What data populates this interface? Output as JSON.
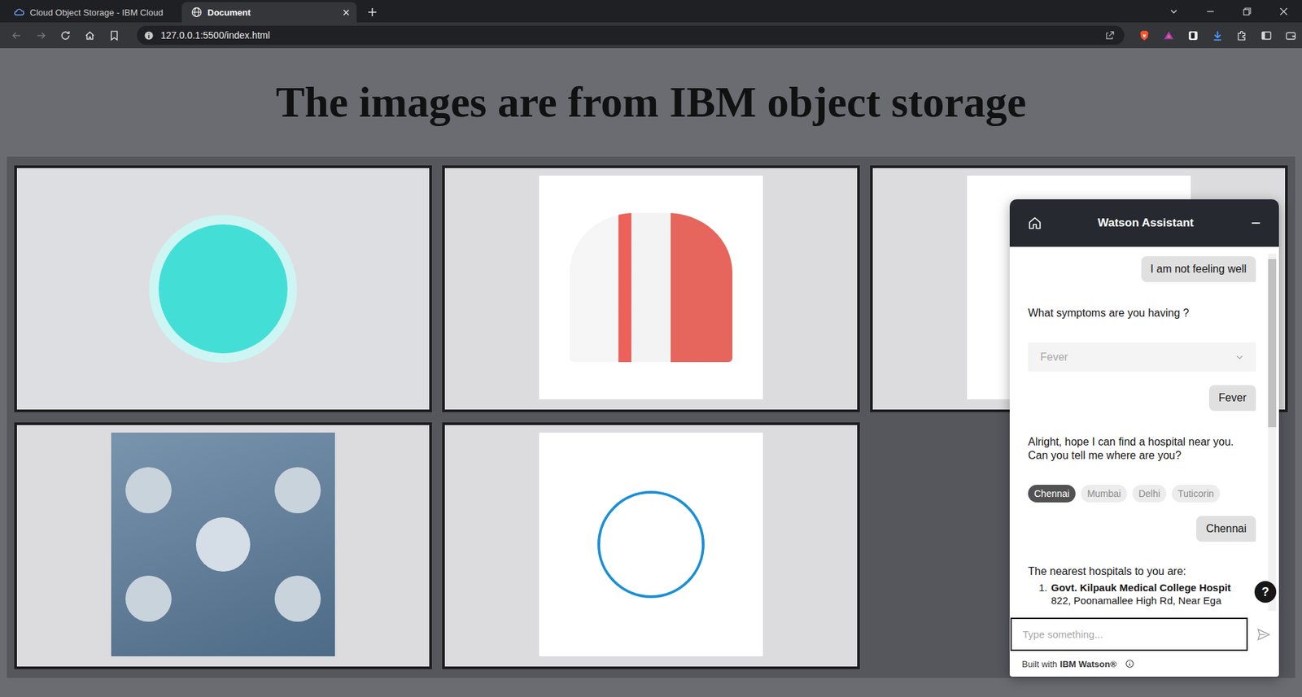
{
  "browser": {
    "tabs": [
      {
        "label": "Cloud Object Storage - IBM Cloud",
        "selected": false
      },
      {
        "label": "Document",
        "selected": true
      }
    ],
    "address": "127.0.0.1:5500/index.html"
  },
  "page": {
    "heading": "The images are from IBM object storage",
    "images": [
      {
        "kind": "ring"
      },
      {
        "kind": "people"
      },
      {
        "kind": "building"
      },
      {
        "kind": "network"
      },
      {
        "kind": "diagram"
      }
    ]
  },
  "chat": {
    "title": "Watson Assistant",
    "messages": [
      {
        "kind": "user",
        "text": "I am not feeling well"
      },
      {
        "kind": "bot",
        "text": "What symptoms are you having ?"
      },
      {
        "kind": "select",
        "value": "Fever",
        "disabled": true
      },
      {
        "kind": "user",
        "text": "Fever"
      },
      {
        "kind": "bot",
        "text": "Alright, hope I can find a hospital near you. Can you tell me where are you?"
      },
      {
        "kind": "options",
        "options": [
          {
            "label": "Chennai",
            "selected": true
          },
          {
            "label": "Mumbai",
            "selected": false
          },
          {
            "label": "Delhi",
            "selected": false
          },
          {
            "label": "Tuticorin",
            "selected": false
          }
        ]
      },
      {
        "kind": "user",
        "text": "Chennai"
      },
      {
        "kind": "list",
        "text": "The nearest hospitals to you are:",
        "items": [
          {
            "number": "1.",
            "name": "Govt. Kilpauk Medical College Hospit",
            "address": "822, Poonamallee High Rd, Near Ega"
          }
        ]
      }
    ],
    "scrollbar": {
      "level": 0.47
    },
    "help": "?",
    "input": {
      "placeholder": "Type something..."
    },
    "footer": {
      "prefix": "Built with",
      "brand": "IBM Watson®"
    }
  }
}
